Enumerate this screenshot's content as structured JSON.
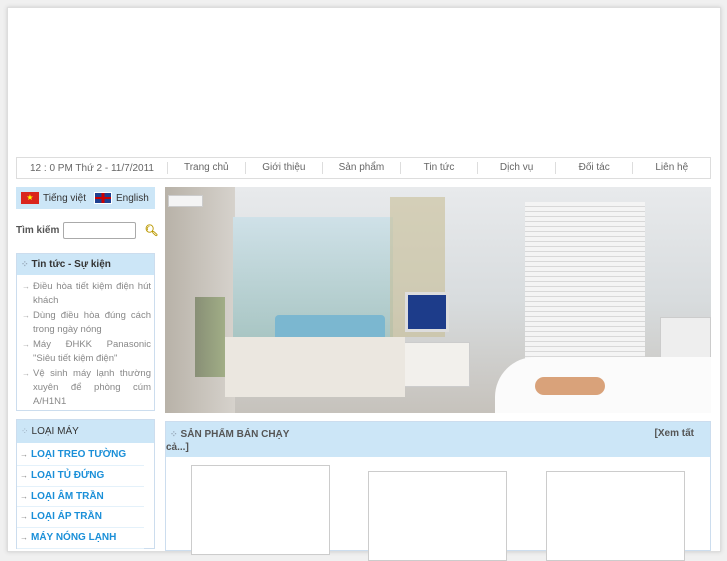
{
  "nav": {
    "datetime": "12 : 0 PM Thứ 2 - 11/7/2011",
    "items": [
      "Trang chủ",
      "Giới thiệu",
      "Sản phẩm",
      "Tin tức",
      "Dịch vụ",
      "Đối tác",
      "Liên hệ"
    ]
  },
  "lang": {
    "vi": "Tiếng việt",
    "en": "English"
  },
  "search": {
    "label": "Tìm kiếm",
    "value": ""
  },
  "news": {
    "title": "Tin tức - Sự kiện",
    "items": [
      "Điều hòa tiết kiệm điện hút khách",
      "Dùng điều hòa đúng cách trong ngày nóng",
      "Máy ĐHKK Panasonic \"Siêu tiết kiệm điện\"",
      "Vệ sinh máy lạnh thường xuyên để phòng cúm A/H1N1"
    ]
  },
  "types": {
    "title": "LOẠI MÁY",
    "items": [
      "LOẠI TREO TƯỜNG",
      "LOẠI TỦ ĐỨNG",
      "LOẠI ÂM TRẦN",
      "LOẠI ÁP TRẦN",
      "MÁY NÓNG LẠNH"
    ]
  },
  "products": {
    "title": "SẢN PHẨM BÁN CHẠY",
    "more_a": "[Xem tất",
    "more_b": "cả...]"
  },
  "colors": {
    "accent": "#1a8fd8",
    "header_bg": "#cce6f7"
  }
}
